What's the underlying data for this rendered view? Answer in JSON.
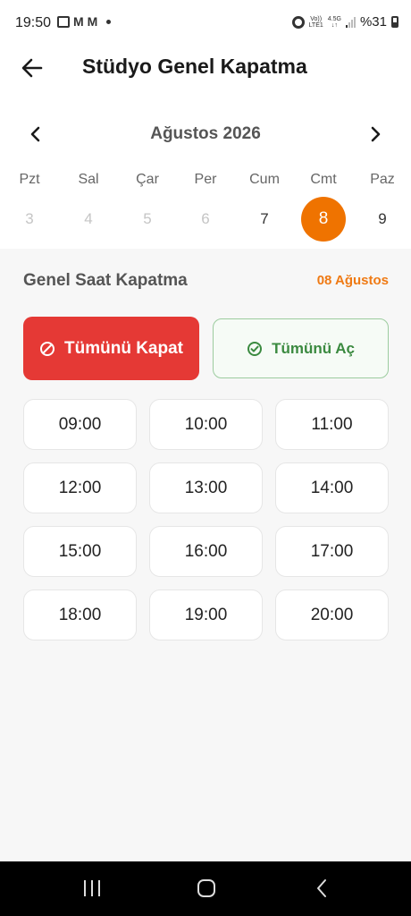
{
  "status_bar": {
    "time": "19:50",
    "left_letters": [
      "M",
      "M"
    ],
    "network_top": "Vo))",
    "network_bottom": "LTE1",
    "gen_top": "4.5G",
    "gen_bottom": "↓↑",
    "battery": "%31"
  },
  "header": {
    "title": "Stüdyo Genel Kapatma",
    "back_icon": "arrow-left-icon"
  },
  "calendar": {
    "month": "Ağustos 2026",
    "weekdays": [
      "Pzt",
      "Sal",
      "Çar",
      "Per",
      "Cum",
      "Cmt",
      "Paz"
    ],
    "days": [
      {
        "label": "3",
        "state": "past"
      },
      {
        "label": "4",
        "state": "past"
      },
      {
        "label": "5",
        "state": "past"
      },
      {
        "label": "6",
        "state": "past"
      },
      {
        "label": "7",
        "state": "normal"
      },
      {
        "label": "8",
        "state": "selected"
      },
      {
        "label": "9",
        "state": "normal"
      }
    ],
    "selected_color": "#ef7300"
  },
  "section": {
    "title": "Genel Saat Kapatma",
    "date": "08 Ağustos"
  },
  "actions": {
    "close_all": "Tümünü Kapat",
    "close_all_icon": "block-icon",
    "close_all_color": "#e53935",
    "open_all": "Tümünü Aç",
    "open_all_icon": "check-circle-icon",
    "open_all_color": "#3b8a40"
  },
  "slots": [
    "09:00",
    "10:00",
    "11:00",
    "12:00",
    "13:00",
    "14:00",
    "15:00",
    "16:00",
    "17:00",
    "18:00",
    "19:00",
    "20:00"
  ]
}
